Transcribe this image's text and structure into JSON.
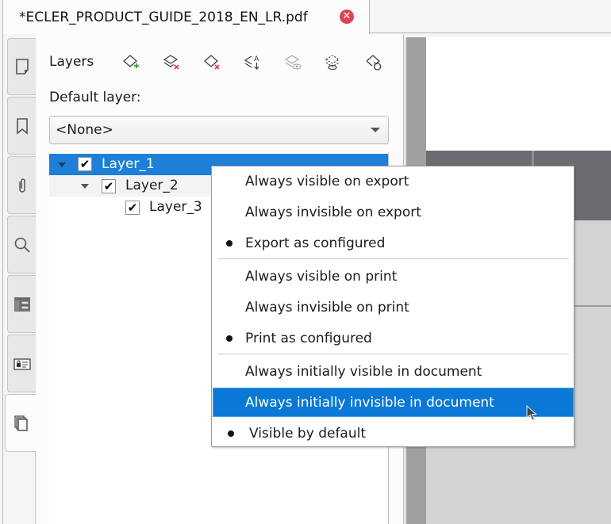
{
  "tab": {
    "title": "*ECLER_PRODUCT_GUIDE_2018_EN_LR.pdf",
    "close_glyph": "✕",
    "close_color": "#da4453"
  },
  "sidebar": {
    "tabs": [
      {
        "name": "thumbnails",
        "icon": "page-icon",
        "active": false
      },
      {
        "name": "bookmarks",
        "icon": "bookmark-icon",
        "active": false
      },
      {
        "name": "attachments",
        "icon": "paperclip-icon",
        "active": false
      },
      {
        "name": "search",
        "icon": "search-icon",
        "active": false
      },
      {
        "name": "structure",
        "icon": "structure-tree-icon",
        "active": false
      },
      {
        "name": "signatures",
        "icon": "signature-card-icon",
        "active": false
      },
      {
        "name": "layers",
        "icon": "layers-icon",
        "active": true
      }
    ]
  },
  "layers_panel": {
    "title": "Layers",
    "toolbar": [
      {
        "name": "add-layer",
        "icon": "add-layer-icon",
        "enabled": true
      },
      {
        "name": "remove-layers",
        "icon": "remove-layers-icon",
        "enabled": true
      },
      {
        "name": "remove-layer",
        "icon": "remove-layer-icon",
        "enabled": true
      },
      {
        "name": "rename-layer",
        "icon": "rename-layer-icon",
        "enabled": true
      },
      {
        "name": "layer-visibility",
        "icon": "layer-eye-icon",
        "enabled": false
      },
      {
        "name": "layer-optional-content",
        "icon": "dashed-layers-icon",
        "enabled": true
      },
      {
        "name": "reset-layer",
        "icon": "reset-layer-icon",
        "enabled": true
      }
    ],
    "default_layer_label": "Default layer:",
    "default_layer_value": "<None>",
    "tree": [
      {
        "label": "Layer_1",
        "checked": true,
        "check_glyph": "✔",
        "level": 0,
        "expanded": true,
        "selected": true
      },
      {
        "label": "Layer_2",
        "checked": true,
        "check_glyph": "✔",
        "level": 1,
        "expanded": true,
        "selected": false
      },
      {
        "label": "Layer_3",
        "checked": true,
        "check_glyph": "✔",
        "level": 2,
        "expanded": false,
        "selected": false
      }
    ]
  },
  "context_menu": {
    "groups": [
      {
        "items": [
          {
            "label": "Always visible on export",
            "checked": false
          },
          {
            "label": "Always invisible on export",
            "checked": false
          },
          {
            "label": "Export as configured",
            "checked": true
          }
        ]
      },
      {
        "items": [
          {
            "label": "Always visible on print",
            "checked": false
          },
          {
            "label": "Always invisible on print",
            "checked": false
          },
          {
            "label": "Print as configured",
            "checked": true
          }
        ]
      },
      {
        "items": [
          {
            "label": "Always initially visible in document",
            "checked": false
          },
          {
            "label": "Always initially invisible in document",
            "checked": false,
            "highlighted": true
          },
          {
            "label": "Visible by default",
            "checked": true
          }
        ]
      }
    ]
  },
  "colors": {
    "selection": "#1e7fd8",
    "menu_highlight": "#0a78d6"
  }
}
